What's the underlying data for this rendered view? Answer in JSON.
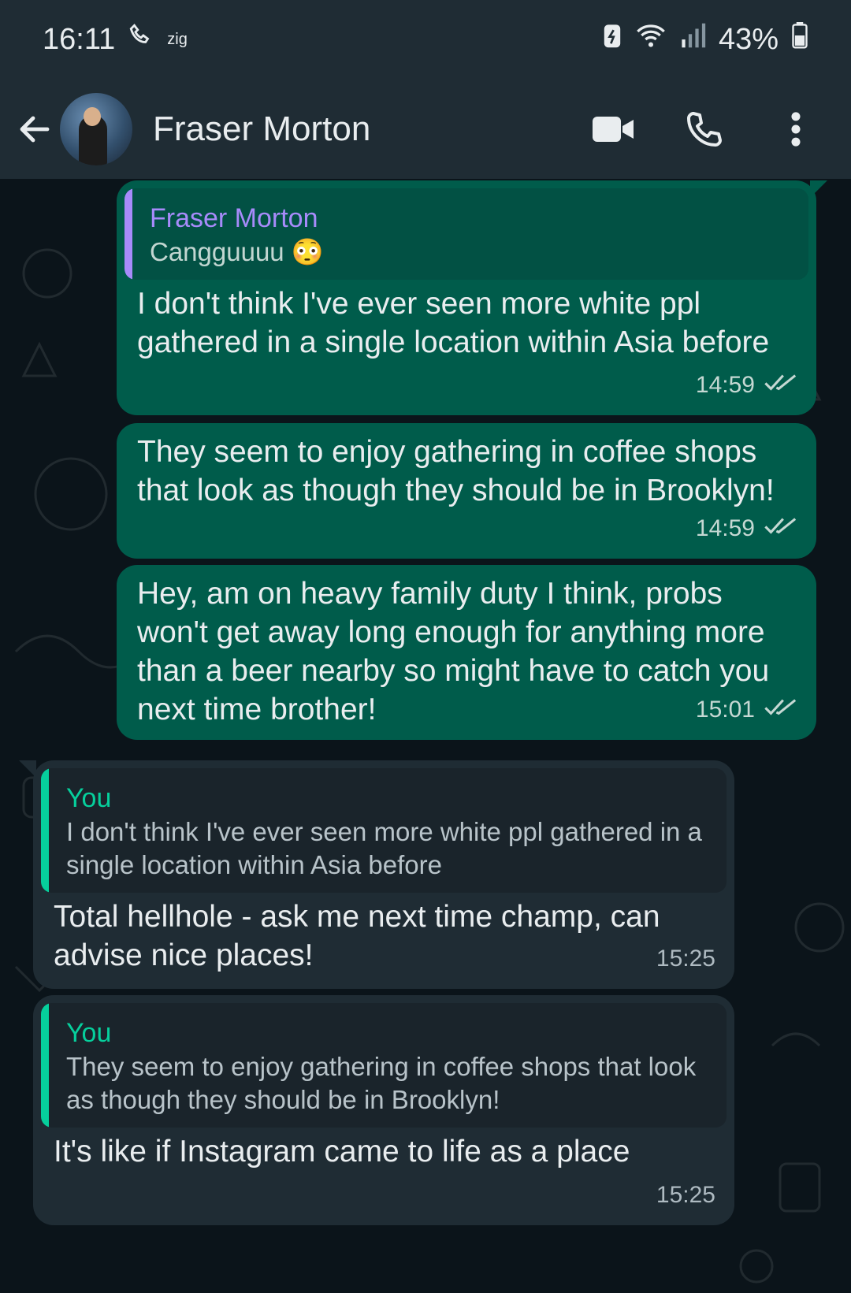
{
  "status_bar": {
    "time": "16:11",
    "carrier_small": "zig",
    "battery_percent": "43%"
  },
  "header": {
    "contact_name": "Fraser Morton"
  },
  "colors": {
    "outgoing_bubble": "#005c4b",
    "incoming_bubble": "#1f2c34",
    "reply_author_outgoing": "#a78bfa",
    "reply_author_incoming": "#06cf9c",
    "background": "#0b141a"
  },
  "messages": [
    {
      "direction": "outgoing",
      "reply": {
        "author": "Fraser Morton",
        "text": "Cangguuuu 😳"
      },
      "text": "I don't think I've ever seen more white ppl gathered in a single location within Asia before",
      "time": "14:59",
      "status_icon": "double-check-icon"
    },
    {
      "direction": "outgoing",
      "text": "They seem to enjoy gathering in coffee shops that look as though they should be in Brooklyn!",
      "time": "14:59",
      "status_icon": "double-check-icon"
    },
    {
      "direction": "outgoing",
      "text": "Hey, am on heavy family duty I think, probs won't get away long enough for anything more than a beer nearby so might have to catch you next time brother!",
      "time": "15:01",
      "status_icon": "double-check-icon"
    },
    {
      "direction": "incoming",
      "reply": {
        "author": "You",
        "text": "I don't think I've ever seen more white ppl gathered in a single location within Asia before"
      },
      "text": "Total hellhole - ask me next time champ, can advise nice places!",
      "time": "15:25"
    },
    {
      "direction": "incoming",
      "reply": {
        "author": "You",
        "text": "They seem to enjoy gathering in coffee shops that look as though they should be in Brooklyn!"
      },
      "text": "It's like if Instagram came to life as a place",
      "time": "15:25"
    }
  ]
}
